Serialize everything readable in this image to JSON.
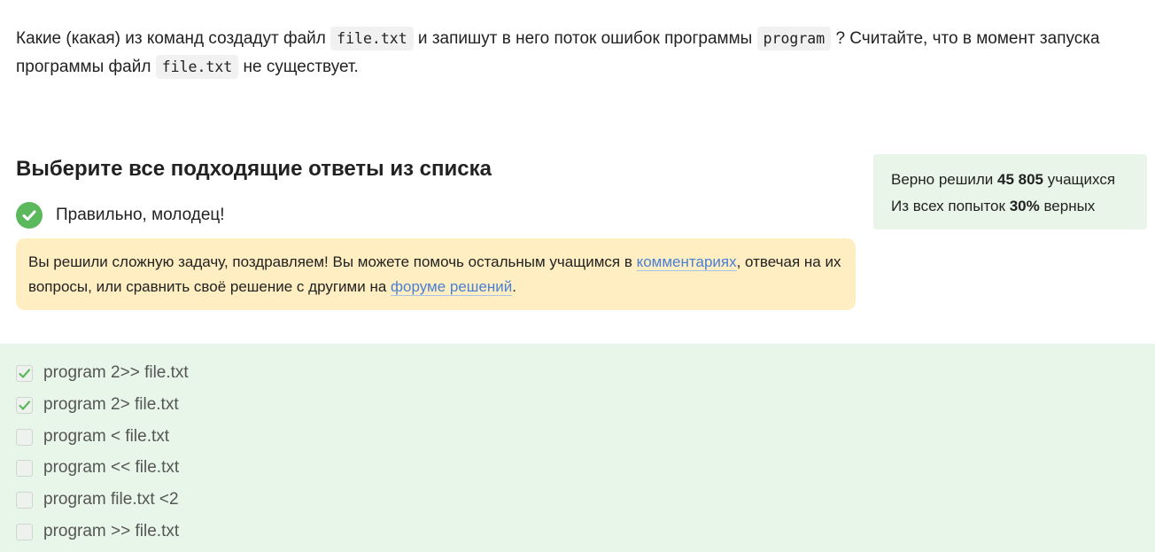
{
  "question": {
    "part1": "Какие (какая) из команд создадут файл ",
    "code1": "file.txt",
    "part2": " и запишут в него поток ошибок программы ",
    "code2": "program",
    "part3": " ? Считайте, что в момент запуска программы файл ",
    "code3": "file.txt",
    "part4": " не существует."
  },
  "answers_title": "Выберите все подходящие ответы из списка",
  "result": {
    "message": "Правильно, молодец!",
    "icon": "check-circle-icon",
    "color": "#5cb85c"
  },
  "notice": {
    "text1": "Вы решили сложную задачу, поздравляем! Вы можете помочь остальным учащимся в ",
    "link1": "комментариях",
    "text2": ", отвечая на их вопросы, или сравнить своё решение с другими на ",
    "link2": "форуме решений",
    "text3": "."
  },
  "stats": {
    "line1_prefix": "Верно решили ",
    "line1_count": "45 805",
    "line1_suffix": " учащихся",
    "line2_prefix": "Из всех попыток ",
    "line2_value": "30%",
    "line2_suffix": " верных"
  },
  "options": [
    {
      "label": "program 2>> file.txt",
      "checked": true
    },
    {
      "label": "program 2> file.txt",
      "checked": true
    },
    {
      "label": "program < file.txt",
      "checked": false
    },
    {
      "label": "program << file.txt",
      "checked": false
    },
    {
      "label": "program file.txt <2",
      "checked": false
    },
    {
      "label": "program >> file.txt",
      "checked": false
    }
  ]
}
